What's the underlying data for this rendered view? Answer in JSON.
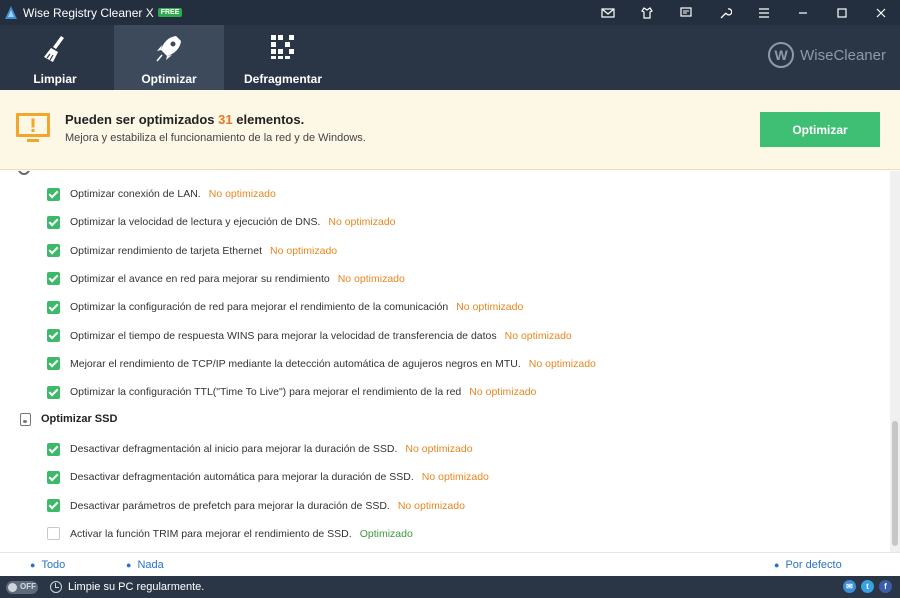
{
  "window": {
    "title": "Wise Registry Cleaner X",
    "badge": "FREE"
  },
  "nav": {
    "tabs": [
      {
        "label": "Limpiar",
        "icon": "broom-icon",
        "active": false
      },
      {
        "label": "Optimizar",
        "icon": "rocket-icon",
        "active": true
      },
      {
        "label": "Defragmentar",
        "icon": "defrag-icon",
        "active": false
      }
    ],
    "brand": "WiseCleaner",
    "brand_mark": "W"
  },
  "banner": {
    "title_before": "Pueden ser optimizados",
    "count": "31",
    "title_after": "elementos.",
    "subtitle": "Mejora y estabiliza el funcionamiento de la red y de Windows.",
    "button": "Optimizar"
  },
  "colors": {
    "accent_green": "#3fbf73",
    "status_orange": "#e8861f",
    "status_ok": "#3a9a3a",
    "titlebar": "#232f3e"
  },
  "network_items": [
    {
      "text": "Optimizar conexión de LAN.",
      "status": "No optimizado",
      "checked": true
    },
    {
      "text": "Optimizar la velocidad de lectura y ejecución de DNS.",
      "status": "No optimizado",
      "checked": true
    },
    {
      "text": "Optimizar rendimiento de tarjeta Ethernet",
      "status": "No optimizado",
      "checked": true
    },
    {
      "text": "Optimizar el avance en red para mejorar su rendimiento",
      "status": "No optimizado",
      "checked": true
    },
    {
      "text": "Optimizar la configuración de red para mejorar el rendimiento de la comunicación",
      "status": "No optimizado",
      "checked": true
    },
    {
      "text": "Optimizar el tiempo de respuesta WINS para mejorar la velocidad de transferencia de datos",
      "status": "No optimizado",
      "checked": true
    },
    {
      "text": "Mejorar el rendimiento de TCP/IP mediante la detección automática de agujeros negros en MTU.",
      "status": "No optimizado",
      "checked": true
    },
    {
      "text": "Optimizar la configuración TTL(\"Time To Live\") para mejorar el rendimiento de la red",
      "status": "No optimizado",
      "checked": true
    }
  ],
  "ssd_section": {
    "title": "Optimizar SSD",
    "items": [
      {
        "text": "Desactivar defragmentación al inicio para mejorar la duración de SSD.",
        "status": "No optimizado",
        "checked": true
      },
      {
        "text": "Desactivar defragmentación automática para mejorar la duración de SSD.",
        "status": "No optimizado",
        "checked": true
      },
      {
        "text": "Desactivar parámetros de prefetch para mejorar la duración de SSD.",
        "status": "No optimizado",
        "checked": true
      },
      {
        "text": "Activar la función TRIM para mejorar el rendimiento de SSD.",
        "status": "Optimizado",
        "checked": false
      }
    ]
  },
  "links": {
    "all": "Todo",
    "none": "Nada",
    "default": "Por defecto"
  },
  "status_bar": {
    "toggle": "OFF",
    "text": "Limpie su PC regularmente."
  }
}
